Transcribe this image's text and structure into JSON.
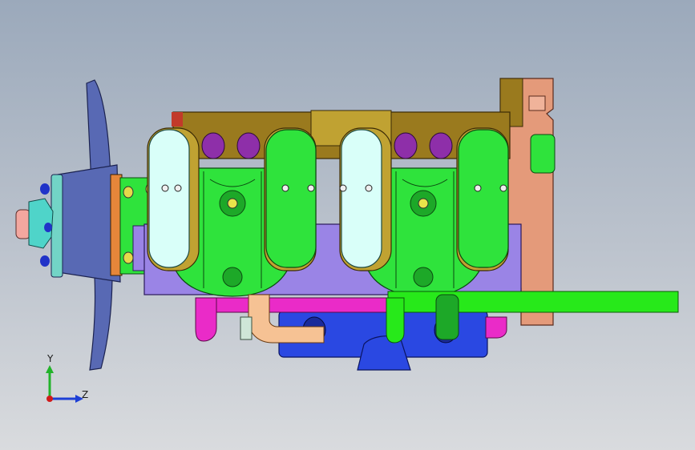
{
  "viewport": {
    "background_top": "#9ba9bb",
    "background_bottom": "#d9dbde"
  },
  "model": {
    "colors": {
      "block_purple": "#9a84e6",
      "head_olive": "#9a7a1e",
      "head_olive_light": "#c0a232",
      "cover_light": "#d9fff9",
      "cylinder_green": "#2fe33c",
      "cylinder_green_dark": "#1da828",
      "port_purple": "#8e2fa9",
      "bracket_salmon": "#e49a7a",
      "bracket_salmon_light": "#f0b39a",
      "manifold_blue": "#2a48e2",
      "pipe_magenta": "#ea2bc8",
      "pipe_green": "#27e91a",
      "pipe_orange": "#f6c294",
      "pipe_pale": "#cfe6d7",
      "fan_blue": "#5869b4",
      "hub_orange": "#e5863a",
      "hub_teal": "#72d4c6",
      "nut_teal": "#4fd4c9",
      "bolt_blue": "#2033c8",
      "shaft_pink": "#f3a79f"
    }
  },
  "triad": {
    "y_label": "Y",
    "z_label": "Z",
    "y_color": "#22b32a",
    "z_color": "#1d3fd6",
    "x_color": "#d11a1a"
  }
}
